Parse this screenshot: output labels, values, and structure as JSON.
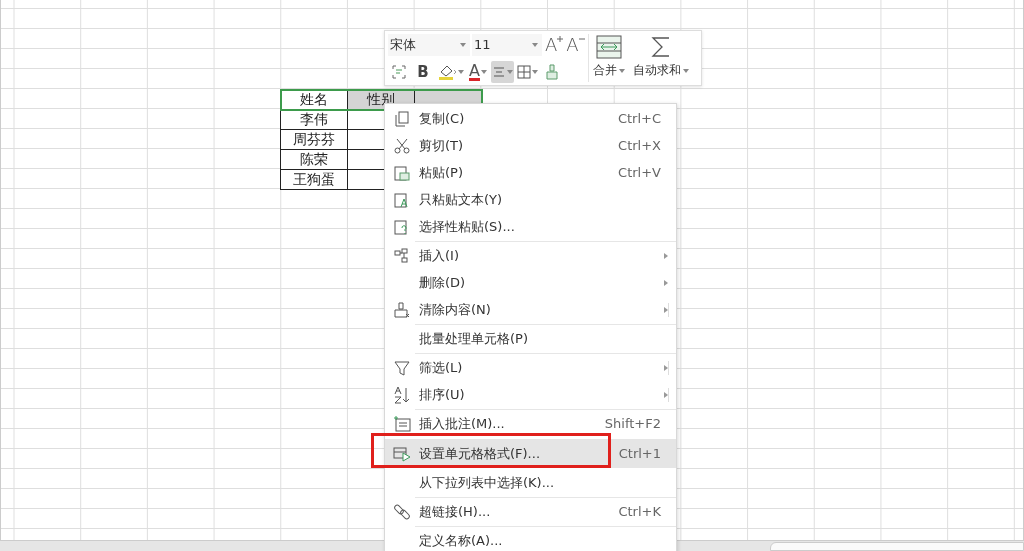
{
  "sheet": {
    "header": {
      "selected": true,
      "cells": [
        {
          "text": "姓名",
          "active": true
        },
        {
          "text": "性别",
          "active": false
        },
        {
          "text": "",
          "active": false
        }
      ]
    },
    "rows": [
      [
        "李伟"
      ],
      [
        "周芬芬"
      ],
      [
        "陈荣"
      ],
      [
        "王狗蛋"
      ]
    ]
  },
  "toolbar": {
    "font_name": "宋体",
    "font_size": "11",
    "grow_glyph": "A",
    "shrink_glyph": "A",
    "bold_glyph": "B",
    "color_glyph": "A",
    "tools": [
      {
        "selected": false
      },
      {
        "selected": false
      },
      {
        "selected": false
      },
      {
        "selected": false
      },
      {
        "selected": true
      },
      {
        "selected": false
      },
      {
        "selected": false
      }
    ],
    "merge_label": "合并",
    "autosum_label": "自动求和"
  },
  "menu": [
    {
      "kind": "item",
      "label": "复制(C)",
      "shortcut": "Ctrl+C",
      "submenu": false,
      "split": false,
      "highlighted": false,
      "marked": false
    },
    {
      "kind": "item",
      "label": "剪切(T)",
      "shortcut": "Ctrl+X",
      "submenu": false,
      "split": false,
      "highlighted": false,
      "marked": false
    },
    {
      "kind": "item",
      "label": "粘贴(P)",
      "shortcut": "Ctrl+V",
      "submenu": false,
      "split": false,
      "highlighted": false,
      "marked": false
    },
    {
      "kind": "item",
      "label": "只粘贴文本(Y)",
      "submenu": false,
      "split": false,
      "highlighted": false,
      "marked": false
    },
    {
      "kind": "item",
      "label": "选择性粘贴(S)...",
      "submenu": false,
      "split": false,
      "highlighted": false,
      "marked": false
    },
    {
      "kind": "separator"
    },
    {
      "kind": "item",
      "label": "插入(I)",
      "submenu": true,
      "split": false,
      "highlighted": false,
      "marked": false
    },
    {
      "kind": "item",
      "label": "删除(D)",
      "submenu": true,
      "split": false,
      "highlighted": false,
      "marked": false
    },
    {
      "kind": "item",
      "label": "清除内容(N)",
      "submenu": true,
      "split": true,
      "highlighted": false,
      "marked": false
    },
    {
      "kind": "separator"
    },
    {
      "kind": "item",
      "label": "批量处理单元格(P)",
      "submenu": false,
      "split": false,
      "highlighted": false,
      "marked": false
    },
    {
      "kind": "separator"
    },
    {
      "kind": "item",
      "label": "筛选(L)",
      "submenu": true,
      "split": true,
      "highlighted": false,
      "marked": false
    },
    {
      "kind": "item",
      "label": "排序(U)",
      "submenu": true,
      "split": true,
      "highlighted": false,
      "marked": false
    },
    {
      "kind": "separator"
    },
    {
      "kind": "item",
      "label": "插入批注(M)...",
      "shortcut": "Shift+F2",
      "submenu": false,
      "split": false,
      "highlighted": false,
      "marked": false
    },
    {
      "kind": "item",
      "label": "设置单元格格式(F)...",
      "shortcut": "Ctrl+1",
      "submenu": false,
      "split": false,
      "highlighted": true,
      "marked": true
    },
    {
      "kind": "item",
      "label": "从下拉列表中选择(K)...",
      "submenu": false,
      "split": false,
      "highlighted": false,
      "marked": false
    },
    {
      "kind": "separator"
    },
    {
      "kind": "item",
      "label": "超链接(H)...",
      "shortcut": "Ctrl+K",
      "submenu": false,
      "split": false,
      "highlighted": false,
      "marked": false
    },
    {
      "kind": "separator"
    },
    {
      "kind": "item",
      "label": "定义名称(A)...",
      "submenu": false,
      "split": false,
      "highlighted": false,
      "marked": false
    }
  ]
}
